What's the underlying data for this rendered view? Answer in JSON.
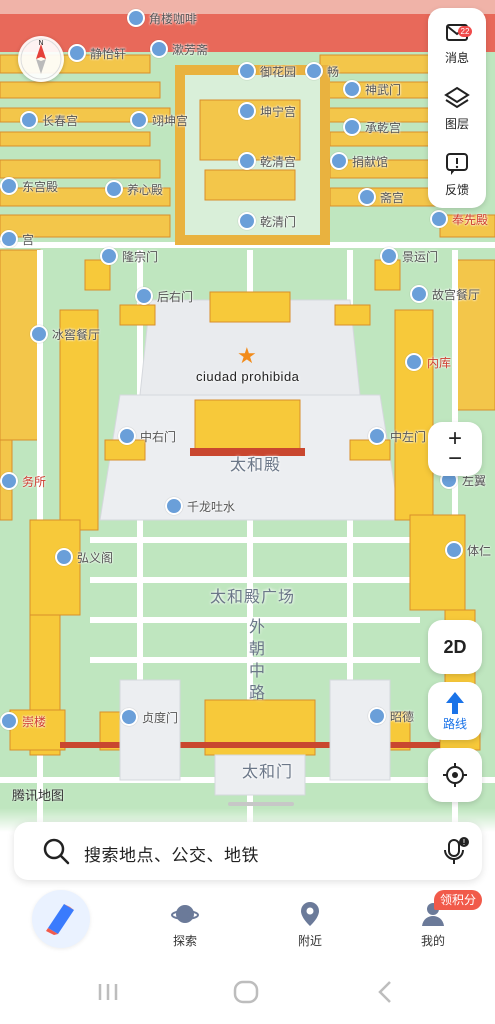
{
  "map": {
    "center_label": "ciudad prohibida",
    "main_hall": "太和殿",
    "plaza": "太和殿广场",
    "vertical_road": [
      "外",
      "朝",
      "中",
      "路"
    ],
    "gate_south": "太和门",
    "attribution": "腾讯地图",
    "pois": [
      {
        "name": "角楼咖啡",
        "style": "default"
      },
      {
        "name": "静怡轩",
        "style": "default"
      },
      {
        "name": "漱芳斋",
        "style": "default"
      },
      {
        "name": "御花园",
        "style": "default"
      },
      {
        "name": "畅",
        "style": "default"
      },
      {
        "name": "神武门",
        "style": "default"
      },
      {
        "name": "长春宫",
        "style": "default"
      },
      {
        "name": "翊坤宫",
        "style": "default"
      },
      {
        "name": "坤宁宫",
        "style": "default"
      },
      {
        "name": "承乾宫",
        "style": "default"
      },
      {
        "name": "东宫殿",
        "style": "default"
      },
      {
        "name": "养心殿",
        "style": "default"
      },
      {
        "name": "乾清宫",
        "style": "default"
      },
      {
        "name": "捐献馆",
        "style": "default"
      },
      {
        "name": "斋宫",
        "style": "default"
      },
      {
        "name": "奉先殿",
        "style": "red"
      },
      {
        "name": "宫",
        "style": "default"
      },
      {
        "name": "乾清门",
        "style": "default"
      },
      {
        "name": "隆宗门",
        "style": "default"
      },
      {
        "name": "景运门",
        "style": "default"
      },
      {
        "name": "后右门",
        "style": "default"
      },
      {
        "name": "故宫餐厅",
        "style": "default"
      },
      {
        "name": "冰窖餐厅",
        "style": "default"
      },
      {
        "name": "内库",
        "style": "red"
      },
      {
        "name": "中右门",
        "style": "default"
      },
      {
        "name": "中左门",
        "style": "default"
      },
      {
        "name": "务所",
        "style": "red"
      },
      {
        "name": "左翼",
        "style": "default"
      },
      {
        "name": "千龙吐水",
        "style": "default"
      },
      {
        "name": "弘义阁",
        "style": "default"
      },
      {
        "name": "体仁",
        "style": "default"
      },
      {
        "name": "崇楼",
        "style": "red"
      },
      {
        "name": "贞度门",
        "style": "default"
      },
      {
        "name": "昭德",
        "style": "default"
      }
    ]
  },
  "side_panel": {
    "messages": {
      "label": "消息",
      "badge": "22"
    },
    "layers": {
      "label": "图层"
    },
    "feedback": {
      "label": "反馈"
    }
  },
  "controls": {
    "zoom_in": "+",
    "zoom_out": "−",
    "mode": "2D",
    "route": "路线"
  },
  "search": {
    "placeholder": "搜索地点、公交、地铁",
    "mic_badge": "!"
  },
  "nav": {
    "explore": "探索",
    "nearby": "附近",
    "mine": "我的",
    "points_badge": "领积分"
  },
  "colors": {
    "grass": "#bfe6bf",
    "road": "#ffffff",
    "roof": "#f7c93a",
    "wall": "#e05a48",
    "accent": "#1a73e8",
    "badge": "#f15a4a"
  }
}
